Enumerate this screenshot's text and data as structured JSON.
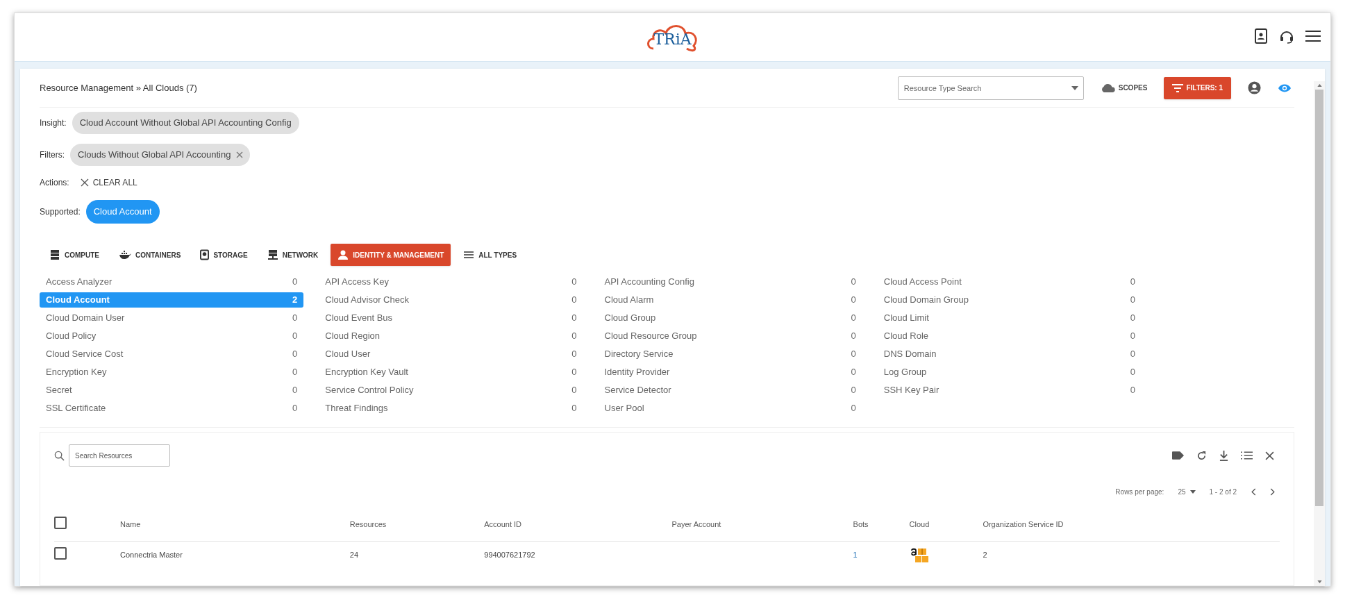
{
  "header": {
    "logo": "TRiA"
  },
  "toolbar": {
    "breadcrumb": "Resource Management » All Clouds (7)",
    "type_search": {
      "placeholder": "Resource Type Search"
    },
    "scopes": "SCOPES",
    "filters_button": "FILTERS: 1"
  },
  "insight": {
    "label": "Insight:",
    "chip": "Cloud Account Without Global API Accounting Config"
  },
  "filters": {
    "label": "Filters:",
    "chips": [
      "Clouds Without Global API Accounting"
    ]
  },
  "actions": {
    "label": "Actions:",
    "clear": "CLEAR ALL"
  },
  "supported": {
    "label": "Supported:",
    "chip": "Cloud Account"
  },
  "tabs": [
    {
      "label": "COMPUTE",
      "kind": "server",
      "selected": false
    },
    {
      "label": "CONTAINERS",
      "kind": "docker",
      "selected": false
    },
    {
      "label": "STORAGE",
      "kind": "disk",
      "selected": false
    },
    {
      "label": "NETWORK",
      "kind": "network",
      "selected": false
    },
    {
      "label": "IDENTITY & MANAGEMENT",
      "kind": "person",
      "selected": true
    },
    {
      "label": "ALL TYPES",
      "kind": "list",
      "selected": false
    }
  ],
  "resource_types": [
    [
      {
        "label": "Access Analyzer",
        "count": "0",
        "selected": false
      },
      {
        "label": "Cloud Account",
        "count": "2",
        "selected": true
      },
      {
        "label": "Cloud Domain User",
        "count": "0",
        "selected": false
      },
      {
        "label": "Cloud Policy",
        "count": "0",
        "selected": false
      },
      {
        "label": "Cloud Service Cost",
        "count": "0",
        "selected": false
      },
      {
        "label": "Encryption Key",
        "count": "0",
        "selected": false
      },
      {
        "label": "Secret",
        "count": "0",
        "selected": false
      },
      {
        "label": "SSL Certificate",
        "count": "0",
        "selected": false
      }
    ],
    [
      {
        "label": "API Access Key",
        "count": "0",
        "selected": false
      },
      {
        "label": "Cloud Advisor Check",
        "count": "0",
        "selected": false
      },
      {
        "label": "Cloud Event Bus",
        "count": "0",
        "selected": false
      },
      {
        "label": "Cloud Region",
        "count": "0",
        "selected": false
      },
      {
        "label": "Cloud User",
        "count": "0",
        "selected": false
      },
      {
        "label": "Encryption Key Vault",
        "count": "0",
        "selected": false
      },
      {
        "label": "Service Control Policy",
        "count": "0",
        "selected": false
      },
      {
        "label": "Threat Findings",
        "count": "0",
        "selected": false
      }
    ],
    [
      {
        "label": "API Accounting Config",
        "count": "0",
        "selected": false
      },
      {
        "label": "Cloud Alarm",
        "count": "0",
        "selected": false
      },
      {
        "label": "Cloud Group",
        "count": "0",
        "selected": false
      },
      {
        "label": "Cloud Resource Group",
        "count": "0",
        "selected": false
      },
      {
        "label": "Directory Service",
        "count": "0",
        "selected": false
      },
      {
        "label": "Identity Provider",
        "count": "0",
        "selected": false
      },
      {
        "label": "Service Detector",
        "count": "0",
        "selected": false
      },
      {
        "label": "User Pool",
        "count": "0",
        "selected": false
      }
    ],
    [
      {
        "label": "Cloud Access Point",
        "count": "0",
        "selected": false
      },
      {
        "label": "Cloud Domain Group",
        "count": "0",
        "selected": false
      },
      {
        "label": "Cloud Limit",
        "count": "0",
        "selected": false
      },
      {
        "label": "Cloud Role",
        "count": "0",
        "selected": false
      },
      {
        "label": "DNS Domain",
        "count": "0",
        "selected": false
      },
      {
        "label": "Log Group",
        "count": "0",
        "selected": false
      },
      {
        "label": "SSH Key Pair",
        "count": "0",
        "selected": false
      }
    ]
  ],
  "table": {
    "search": {
      "placeholder": "Search Resources"
    },
    "rows_per_page_label": "Rows per page:",
    "rows_per_page": "25",
    "range": "1 - 2 of 2",
    "columns": [
      "Name",
      "Resources",
      "Account ID",
      "Payer Account",
      "Bots",
      "Cloud",
      "Organization Service ID"
    ],
    "select_all_checked": false,
    "rows": [
      {
        "checked": false,
        "name": "Connectria Master",
        "resources": "24",
        "account_id": "994007621792",
        "bots": "1",
        "org_service_id": "2"
      }
    ]
  }
}
